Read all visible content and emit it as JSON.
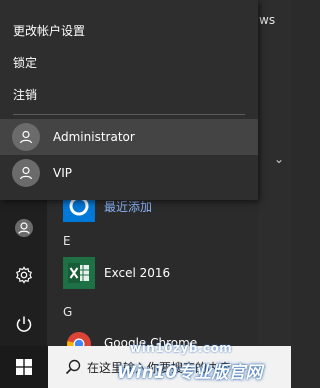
{
  "popup": {
    "menu_items": [
      "更改帐户设置",
      "锁定",
      "注销"
    ],
    "accounts": [
      {
        "name": "Administrator",
        "selected": true
      },
      {
        "name": "VIP",
        "selected": false
      }
    ]
  },
  "start_menu": {
    "edge_text": "ws",
    "recent_label": "最近添加",
    "section_e": "E",
    "excel_label": "Excel 2016",
    "section_g": "G",
    "chrome_label": "Google Chrome"
  },
  "taskbar": {
    "search_placeholder": "在这里输入你要搜索的内容"
  },
  "watermark": {
    "line1": "win10zyb.com",
    "line2": "Win10专业版官网"
  },
  "colors": {
    "accent": "#0078d7",
    "excel_green": "#1e7145"
  }
}
